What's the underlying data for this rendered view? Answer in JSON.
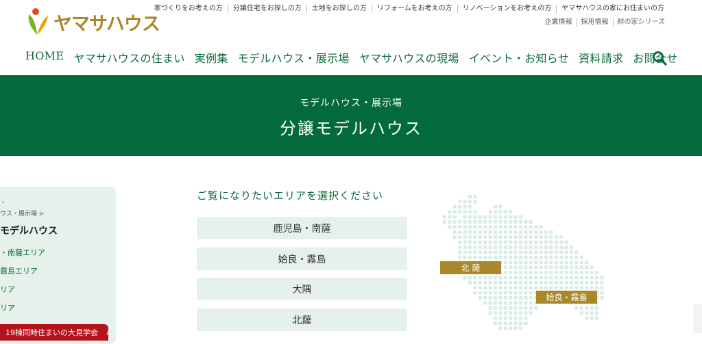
{
  "header": {
    "logo_text": "ヤマサハウス",
    "top_links": [
      "家づくりをお考えの方",
      "分譲住宅をお探しの方",
      "土地をお探しの方",
      "リフォームをお考えの方",
      "リノベーションをお考えの方",
      "ヤマサハウスの家にお住まいの方"
    ],
    "sub_links": [
      "企業情報",
      "採用情報",
      "絆の家シリーズ"
    ],
    "nav": [
      "HOME",
      "ヤマサハウスの住まい",
      "実例集",
      "モデルハウス・展示場",
      "ヤマサハウスの現場",
      "イベント・お知らせ",
      "資料請求",
      "お問合せ"
    ]
  },
  "banner": {
    "subtitle": "モデルハウス・展示場",
    "title": "分譲モデルハウス"
  },
  "sidebar": {
    "dot": "・",
    "breadcrumb": "ウス・展示場 >",
    "title": "モデルハウス",
    "items": [
      "・南薩エリア",
      "霧島エリア",
      "リア",
      "リア"
    ],
    "promo": "19棟同時住まいの大見学会　∧"
  },
  "main": {
    "heading": "ご覧になりたいエリアを選択ください",
    "areas": [
      "鹿児島・南薩",
      "姶良・霧島",
      "大隅",
      "北薩"
    ]
  },
  "map": {
    "labels": [
      "北 薩",
      "姶良・霧島"
    ],
    "dot_color": "#d9ece1",
    "label_color": "#a9882a"
  },
  "colors": {
    "brand_green": "#026a3b",
    "accent_gold": "#a9882a",
    "promo_red": "#b5121b"
  }
}
